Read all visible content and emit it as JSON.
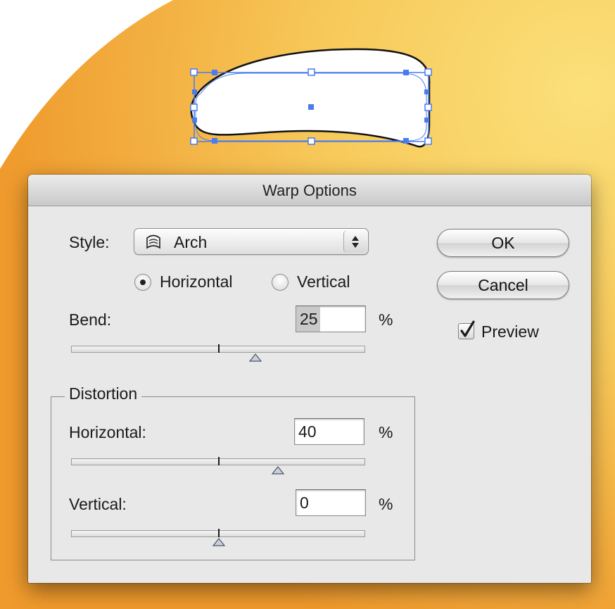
{
  "dialog": {
    "title": "Warp Options",
    "style": {
      "label": "Style:",
      "value": "Arch",
      "icon": "arch-warp-icon"
    },
    "orientation": {
      "options": [
        "Horizontal",
        "Vertical"
      ],
      "selected": "Horizontal"
    },
    "bend": {
      "label": "Bend:",
      "value": "25",
      "unit": "%"
    },
    "distortion": {
      "title": "Distortion",
      "horizontal": {
        "label": "Horizontal:",
        "value": "40",
        "unit": "%"
      },
      "vertical": {
        "label": "Vertical:",
        "value": "0",
        "unit": "%"
      }
    },
    "buttons": {
      "ok": "OK",
      "cancel": "Cancel"
    },
    "preview": {
      "label": "Preview",
      "checked": true
    }
  },
  "colors": {
    "background_orange": "#F2A53A",
    "background_yellow": "#F8D667",
    "selection_blue": "#4A7CF0"
  }
}
